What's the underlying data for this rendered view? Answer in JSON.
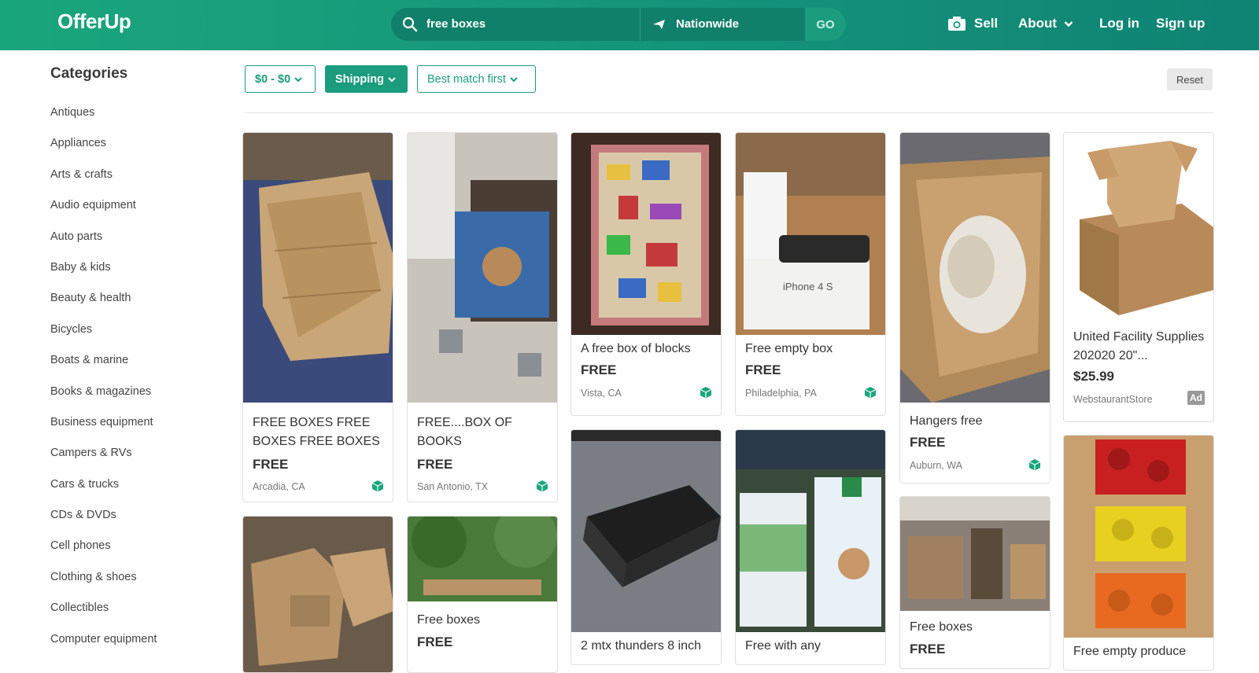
{
  "header": {
    "logo": "OfferUp",
    "search_query": "free boxes",
    "location": "Nationwide",
    "go_label": "GO",
    "nav": {
      "sell": "Sell",
      "about": "About",
      "login": "Log in",
      "signup": "Sign up"
    }
  },
  "sidebar": {
    "title": "Categories",
    "items": [
      "Antiques",
      "Appliances",
      "Arts & crafts",
      "Audio equipment",
      "Auto parts",
      "Baby & kids",
      "Beauty & health",
      "Bicycles",
      "Boats & marine",
      "Books & magazines",
      "Business equipment",
      "Campers & RVs",
      "Cars & trucks",
      "CDs & DVDs",
      "Cell phones",
      "Clothing & shoes",
      "Collectibles",
      "Computer equipment"
    ]
  },
  "filters": {
    "price": "$0 - $0",
    "shipping": "Shipping",
    "sort": "Best match first",
    "reset": "Reset"
  },
  "listings": [
    {
      "title": "FREE BOXES FREE BOXES FREE BOXES",
      "price": "FREE",
      "location": "Arcadia, CA"
    },
    {
      "title": "FREE....BOX OF BOOKS",
      "price": "FREE",
      "location": "San Antonio, TX"
    },
    {
      "title": "A free box of blocks",
      "price": "FREE",
      "location": "Vista, CA"
    },
    {
      "title": "Free empty box",
      "price": "FREE",
      "location": "Philadelphia, PA",
      "image_text": "iPhone 4 S"
    },
    {
      "title": "Hangers free",
      "price": "FREE",
      "location": "Auburn, WA"
    },
    {
      "title": "United Facility Supplies 202020 20\"...",
      "price": "$25.99",
      "seller": "WebstaurantStore",
      "badge": "Ad"
    },
    {
      "title": "",
      "price": "",
      "location": ""
    },
    {
      "title": "Free boxes",
      "price": "FREE",
      "location": ""
    },
    {
      "title": "2 mtx thunders 8 inch",
      "price": "",
      "location": ""
    },
    {
      "title": "Free with any",
      "price": "",
      "location": ""
    },
    {
      "title": "Free boxes",
      "price": "FREE",
      "location": ""
    },
    {
      "title": "Free empty produce",
      "price": "",
      "location": ""
    }
  ],
  "colors": {
    "brand": "#1aa67c",
    "text": "#333333"
  }
}
